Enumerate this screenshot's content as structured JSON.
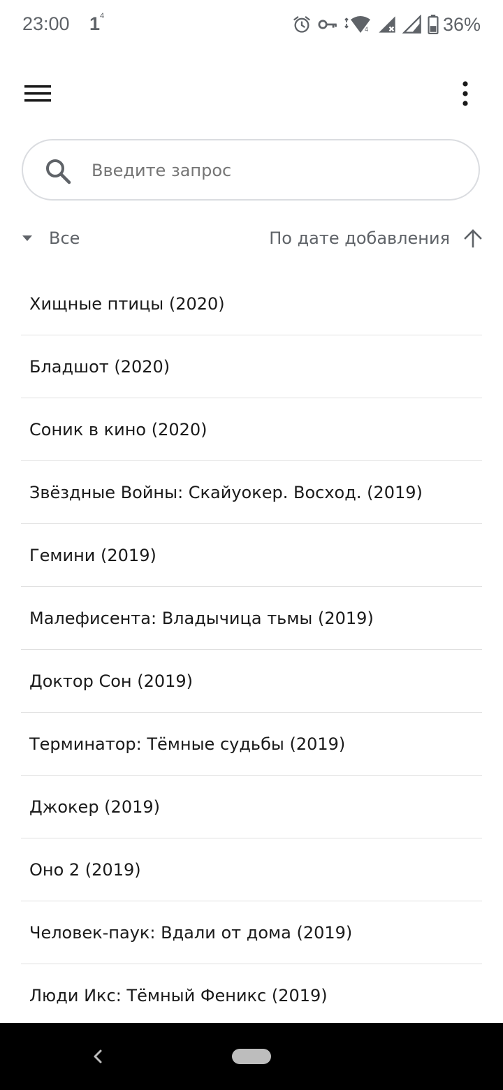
{
  "status_bar": {
    "time": "23:00",
    "notification_digit": "1",
    "notification_super": "4",
    "battery": "36%",
    "icons": [
      "alarm-icon",
      "vpn-key-icon",
      "wifi-icon",
      "signal-icon",
      "signal-no-data-icon",
      "battery-icon"
    ],
    "wifi_badge": "4"
  },
  "app_bar": {
    "menu_icon": "hamburger-menu-icon",
    "more_icon": "more-vert-icon"
  },
  "search": {
    "placeholder": "Введите запрос",
    "value": ""
  },
  "filter": {
    "selected": "Все",
    "icon": "arrow-drop-down-icon"
  },
  "sort": {
    "label": "По дате добавления",
    "direction_icon": "arrow-upward-icon"
  },
  "movies": [
    "Хищные птицы (2020)",
    "Бладшот (2020)",
    "Соник в кино (2020)",
    "Звёздные Войны: Скайуокер. Восход. (2019)",
    "Гемини (2019)",
    "Малефисента: Владычица тьмы (2019)",
    "Доктор Сон (2019)",
    "Терминатор: Тёмные судьбы (2019)",
    "Джокер (2019)",
    "Оно 2 (2019)",
    "Человек-паук: Вдали от дома (2019)",
    "Люди Икс: Тёмный Феникс (2019)"
  ],
  "nav_bar": {
    "back_icon": "back-chevron-icon",
    "home_icon": "home-pill-icon"
  },
  "colors": {
    "background": "#ffffff",
    "text_primary": "#1a1a1a",
    "text_secondary": "#5f6368",
    "divider": "#e0e0e0",
    "search_border": "#dadce0",
    "nav_background": "#000000"
  }
}
